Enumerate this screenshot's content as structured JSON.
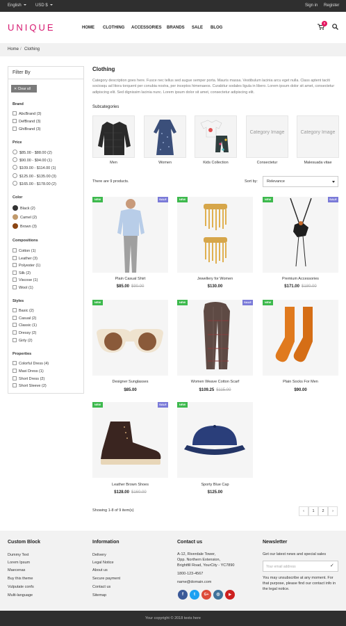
{
  "topbar": {
    "language": "English",
    "currency": "USD $",
    "signin": "Sign in",
    "register": "Register"
  },
  "header": {
    "logo": "UNIQUE",
    "nav": [
      "HOME",
      "CLOTHING",
      "ACCESSORIES",
      "BRANDS",
      "SALE",
      "BLOG"
    ],
    "cart_count": "0",
    "icons": [
      "cart-icon",
      "search-icon"
    ]
  },
  "breadcrumb": {
    "home": "Home",
    "sep": "/",
    "current": "Clothing"
  },
  "filter": {
    "title": "Filter By",
    "clear": "Clear all",
    "brand": {
      "title": "Brand",
      "items": [
        "AbcBrand (3)",
        "DefBrand (3)",
        "GhiBrand (3)"
      ]
    },
    "price": {
      "title": "Price",
      "items": [
        "$85.00 - $88.00 (2)",
        "$90.00 - $94.00 (1)",
        "$109.00 - $114.00 (1)",
        "$125.00 - $135.00 (3)",
        "$165.00 - $178.00 (2)"
      ]
    },
    "color": {
      "title": "Color",
      "items": [
        {
          "label": "Black (2)",
          "hex": "#333333"
        },
        {
          "label": "Camel (2)",
          "hex": "#c19a6b"
        },
        {
          "label": "Brown (3)",
          "hex": "#8b4513"
        }
      ]
    },
    "compositions": {
      "title": "Compositions",
      "items": [
        "Cotton (1)",
        "Leather (3)",
        "Polyester (1)",
        "Silk (2)",
        "Viscose (1)",
        "Wool (1)"
      ]
    },
    "styles": {
      "title": "Styles",
      "items": [
        "Basic (2)",
        "Casual (2)",
        "Classic (1)",
        "Dressy (2)",
        "Girly (2)"
      ]
    },
    "properties": {
      "title": "Properties",
      "items": [
        "Colorful Dress (4)",
        "Maxi Dress (1)",
        "Short Dress (2)",
        "Short Sleeve (2)"
      ]
    }
  },
  "main": {
    "title": "Clothing",
    "description": "Category description goes here. Fusce nec tellus sed augue semper porta. Mauris massa. Vestibulum lacinia arcu eget nulla. Class aptent taciti sociosqu ad litora torquent per conubia nostra, per inceptos himenaeos. Curabitur sodales ligula in libero. Lorem ipsum dolor sit amet, consectetur adipiscing elit. Sed dignissim lacinia nunc. Lorem ipsum dolor sit amet, consectetur adipiscing elit.",
    "subcategories_title": "Subcategories",
    "subcategories": [
      {
        "label": "Men",
        "placeholder": ""
      },
      {
        "label": "Women",
        "placeholder": ""
      },
      {
        "label": "Kids Collection",
        "placeholder": ""
      },
      {
        "label": "Consectetur",
        "placeholder": "Category Image"
      },
      {
        "label": "Malesuada vitae",
        "placeholder": "Category Image"
      }
    ],
    "count_text": "There are 9 products.",
    "sort_label": "Sort by:",
    "sort_value": "Relevance",
    "badges": {
      "new": "NEW",
      "sale": "SALE"
    },
    "products": [
      {
        "name": "Plain Casual Shirt",
        "price": "$85.00",
        "old": "$90.00"
      },
      {
        "name": "Jewellery for Women",
        "price": "$130.00",
        "old": ""
      },
      {
        "name": "Premium Accessories",
        "price": "$171.00",
        "old": "$180.00"
      },
      {
        "name": "Designer Sunglasses",
        "price": "$85.00",
        "old": ""
      },
      {
        "name": "Women Weave Cotton Scarf",
        "price": "$109.25",
        "old": "$115.00"
      },
      {
        "name": "Plain Socks For Men",
        "price": "$90.00",
        "old": ""
      },
      {
        "name": "Leather Brown Shoes",
        "price": "$128.00",
        "old": "$160.00"
      },
      {
        "name": "Sporty Blue Cap",
        "price": "$125.00",
        "old": ""
      }
    ],
    "showing": "Showing 1-8 of 9 item(s)",
    "pagination": {
      "prev": "‹",
      "pages": [
        "1",
        "2"
      ],
      "next": "›"
    }
  },
  "footer": {
    "custom": {
      "title": "Custom Block",
      "links": [
        "Dummy Text",
        "Lorem Ipsum",
        "Maecenas",
        "Buy this theme",
        "Vulputate confs",
        "Multi-language"
      ]
    },
    "info": {
      "title": "Information",
      "links": [
        "Delivery",
        "Legal Notice",
        "About us",
        "Secure payment",
        "Contact us",
        "Sitemap"
      ]
    },
    "contact": {
      "title": "Contact us",
      "lines": [
        "A-12, Riverdale Tower,",
        "Opp. Northern Extension,",
        "Brightfill Road, YourCity - YC7890"
      ],
      "phone": "1800-123-4567",
      "email": "name@domain.com",
      "social": [
        "f",
        "t",
        "G+",
        "◎",
        "▶"
      ]
    },
    "newsletter": {
      "title": "Newsletter",
      "text": "Get our latest news and special sales",
      "placeholder": "Your email address",
      "note": "You may unsubscribe at any moment. For that purpose, please find our contact info in the legal notice."
    },
    "copyright": "Your copyright © 2018 texts here"
  }
}
